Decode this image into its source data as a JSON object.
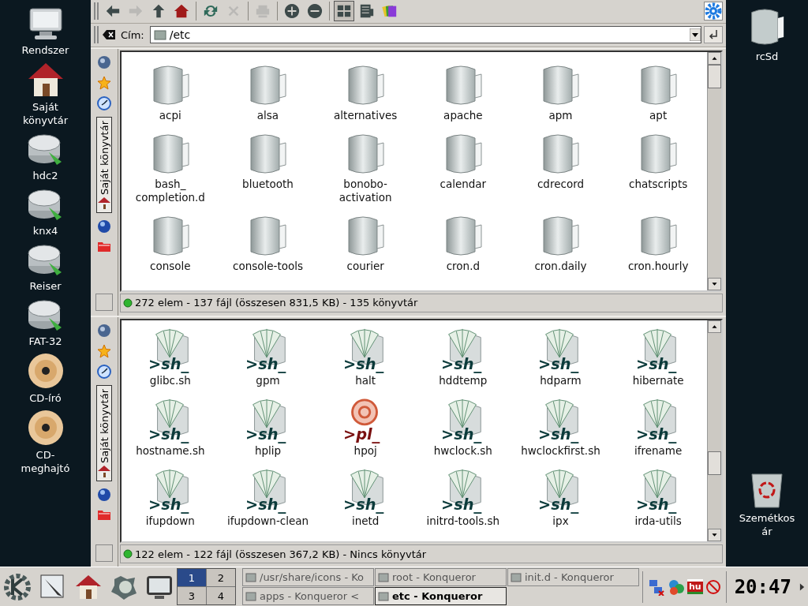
{
  "desktop_left": [
    {
      "label": "Rendszer",
      "kind": "monitor"
    },
    {
      "label": "Saját\nkönyvtár",
      "kind": "home"
    },
    {
      "label": "hdc2",
      "kind": "disk"
    },
    {
      "label": "knx4",
      "kind": "disk"
    },
    {
      "label": "Reiser",
      "kind": "disk"
    },
    {
      "label": "FAT-32",
      "kind": "disk"
    },
    {
      "label": "CD-író",
      "kind": "cd"
    },
    {
      "label": "CD-\nmeghajtó",
      "kind": "cd"
    }
  ],
  "desktop_right": [
    {
      "label": "rcSd",
      "kind": "folder"
    },
    {
      "label": "Szemétkos\nár",
      "kind": "trash"
    }
  ],
  "window": {
    "toolbar": [
      {
        "kind": "back",
        "disabled": false,
        "pressed": false
      },
      {
        "kind": "forward",
        "disabled": true,
        "pressed": false
      },
      {
        "kind": "up",
        "disabled": false,
        "pressed": false
      },
      {
        "kind": "home",
        "disabled": false,
        "pressed": false
      },
      {
        "kind": "sep"
      },
      {
        "kind": "reload",
        "disabled": false,
        "pressed": false
      },
      {
        "kind": "stop",
        "disabled": true,
        "pressed": false
      },
      {
        "kind": "sep"
      },
      {
        "kind": "print",
        "disabled": true,
        "pressed": false
      },
      {
        "kind": "sep"
      },
      {
        "kind": "zoom-in",
        "disabled": false,
        "pressed": false
      },
      {
        "kind": "zoom-out",
        "disabled": false,
        "pressed": false
      },
      {
        "kind": "sep"
      },
      {
        "kind": "icon-view",
        "disabled": false,
        "pressed": true
      },
      {
        "kind": "detail-view",
        "disabled": false,
        "pressed": false
      },
      {
        "kind": "color-view",
        "disabled": false,
        "pressed": false
      }
    ],
    "address": {
      "label": "Cím:",
      "value": "/etc"
    }
  },
  "panes": [
    {
      "sidebar_tab": "Saját könyvtár",
      "status": "272 elem - 137 fájl (összesen 831,5 KB) - 135 könyvtár",
      "items": [
        {
          "label": "acpi",
          "kind": "folder"
        },
        {
          "label": "alsa",
          "kind": "folder"
        },
        {
          "label": "alternatives",
          "kind": "folder"
        },
        {
          "label": "apache",
          "kind": "folder"
        },
        {
          "label": "apm",
          "kind": "folder"
        },
        {
          "label": "apt",
          "kind": "folder"
        },
        {
          "label": "bash_\ncompletion.d",
          "kind": "folder"
        },
        {
          "label": "bluetooth",
          "kind": "folder"
        },
        {
          "label": "bonobo-\nactivation",
          "kind": "folder"
        },
        {
          "label": "calendar",
          "kind": "folder"
        },
        {
          "label": "cdrecord",
          "kind": "folder"
        },
        {
          "label": "chatscripts",
          "kind": "folder"
        },
        {
          "label": "console",
          "kind": "folder"
        },
        {
          "label": "console-tools",
          "kind": "folder"
        },
        {
          "label": "courier",
          "kind": "folder"
        },
        {
          "label": "cron.d",
          "kind": "folder"
        },
        {
          "label": "cron.daily",
          "kind": "folder"
        },
        {
          "label": "cron.hourly",
          "kind": "folder"
        }
      ]
    },
    {
      "sidebar_tab": "Saját könyvtár",
      "status": "122 elem - 122 fájl (összesen 367,2 KB) - Nincs könyvtár",
      "items": [
        {
          "label": "glibc.sh",
          "kind": "shell",
          "badge": ">sh_"
        },
        {
          "label": "gpm",
          "kind": "shell",
          "badge": ">sh_"
        },
        {
          "label": "halt",
          "kind": "shell",
          "badge": ">sh_"
        },
        {
          "label": "hddtemp",
          "kind": "shell",
          "badge": ">sh_"
        },
        {
          "label": "hdparm",
          "kind": "shell",
          "badge": ">sh_"
        },
        {
          "label": "hibernate",
          "kind": "shell",
          "badge": ">sh_"
        },
        {
          "label": "hostname.sh",
          "kind": "shell",
          "badge": ">sh_"
        },
        {
          "label": "hplip",
          "kind": "shell",
          "badge": ">sh_"
        },
        {
          "label": "hpoj",
          "kind": "perl",
          "badge": ">pl_"
        },
        {
          "label": "hwclock.sh",
          "kind": "shell",
          "badge": ">sh_"
        },
        {
          "label": "hwclockfirst.sh",
          "kind": "shell",
          "badge": ">sh_"
        },
        {
          "label": "ifrename",
          "kind": "shell",
          "badge": ">sh_"
        },
        {
          "label": "ifupdown",
          "kind": "shell",
          "badge": ">sh_"
        },
        {
          "label": "ifupdown-clean",
          "kind": "shell",
          "badge": ">sh_"
        },
        {
          "label": "inetd",
          "kind": "shell",
          "badge": ">sh_"
        },
        {
          "label": "initrd-tools.sh",
          "kind": "shell",
          "badge": ">sh_"
        },
        {
          "label": "ipx",
          "kind": "shell",
          "badge": ">sh_"
        },
        {
          "label": "irda-utils",
          "kind": "shell",
          "badge": ">sh_"
        }
      ]
    }
  ],
  "taskbar": {
    "launchers": [
      {
        "kind": "k-menu"
      },
      {
        "kind": "editor"
      },
      {
        "kind": "home"
      },
      {
        "kind": "globe"
      },
      {
        "kind": "monitor"
      }
    ],
    "pager": [
      {
        "label": "1",
        "selected": true
      },
      {
        "label": "2",
        "selected": false
      },
      {
        "label": "3",
        "selected": false
      },
      {
        "label": "4",
        "selected": false
      }
    ],
    "tasks": [
      {
        "label": "/usr/share/icons - Ko",
        "selected": false
      },
      {
        "label": "root - Konqueror",
        "selected": false
      },
      {
        "label": "init.d - Konqueror",
        "selected": false
      },
      {
        "label": "apps - Konqueror <",
        "selected": false
      },
      {
        "label": "etc - Konqueror",
        "selected": true
      }
    ],
    "tray": [
      {
        "kind": "network"
      },
      {
        "kind": "shapes"
      },
      {
        "kind": "keyboard",
        "label": "hu"
      },
      {
        "kind": "blocked"
      }
    ],
    "clock": "20:47"
  }
}
